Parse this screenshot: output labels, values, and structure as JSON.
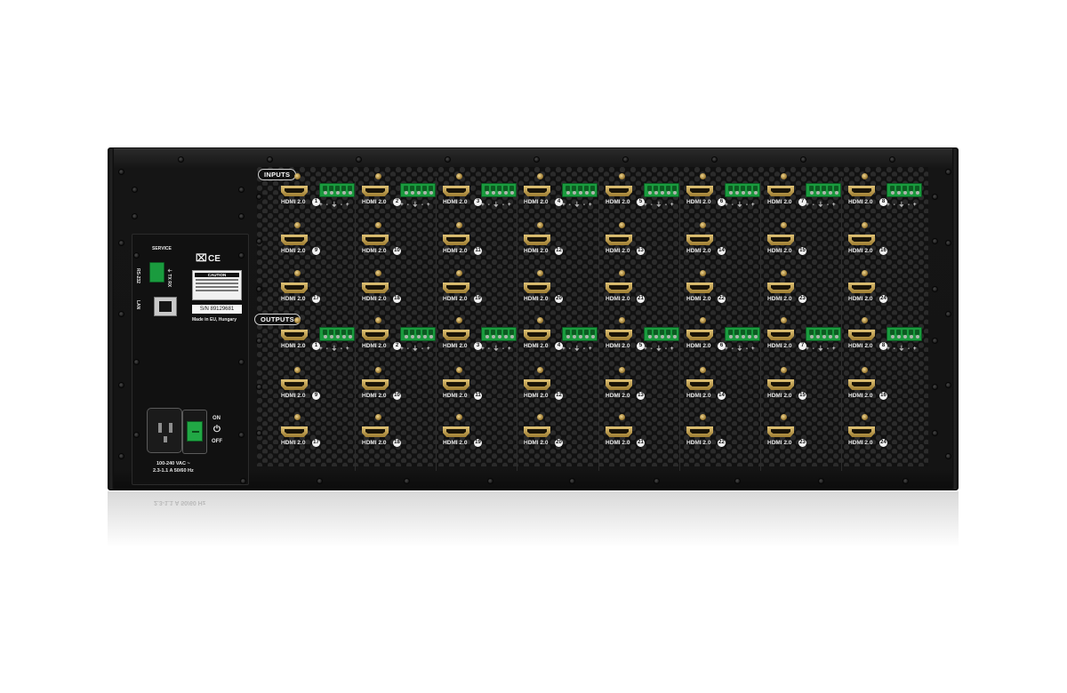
{
  "sections": {
    "inputs": "INPUTS",
    "outputs": "OUTPUTS"
  },
  "port_type": "HDMI 2.0",
  "terminal_pins": "+ - ⏚ - +",
  "input_ports": [
    "1",
    "2",
    "3",
    "4",
    "5",
    "6",
    "7",
    "8",
    "9",
    "10",
    "11",
    "12",
    "13",
    "14",
    "15",
    "16",
    "17",
    "18",
    "19",
    "20",
    "21",
    "22",
    "23",
    "24"
  ],
  "output_ports": [
    "1",
    "2",
    "3",
    "4",
    "5",
    "6",
    "7",
    "8",
    "9",
    "10",
    "11",
    "12",
    "13",
    "14",
    "15",
    "16",
    "17",
    "18",
    "19",
    "20",
    "21",
    "22",
    "23",
    "24"
  ],
  "control_panel": {
    "service": "SERVICE",
    "rs232": "RS-232",
    "rs232_pins": "⏚ TX RX",
    "lan": "LAN",
    "caution": "CAUTION",
    "serial": "S/N 89129681",
    "made_in": "Made in EU, Hungary",
    "ce_mark": "CE",
    "weee_icon": "crossed-bin-icon"
  },
  "power": {
    "on": "ON",
    "off": "OFF",
    "rating_line1": "100-240 VAC ~",
    "rating_line2": "2.3-1.1 A 50/60 Hz"
  }
}
